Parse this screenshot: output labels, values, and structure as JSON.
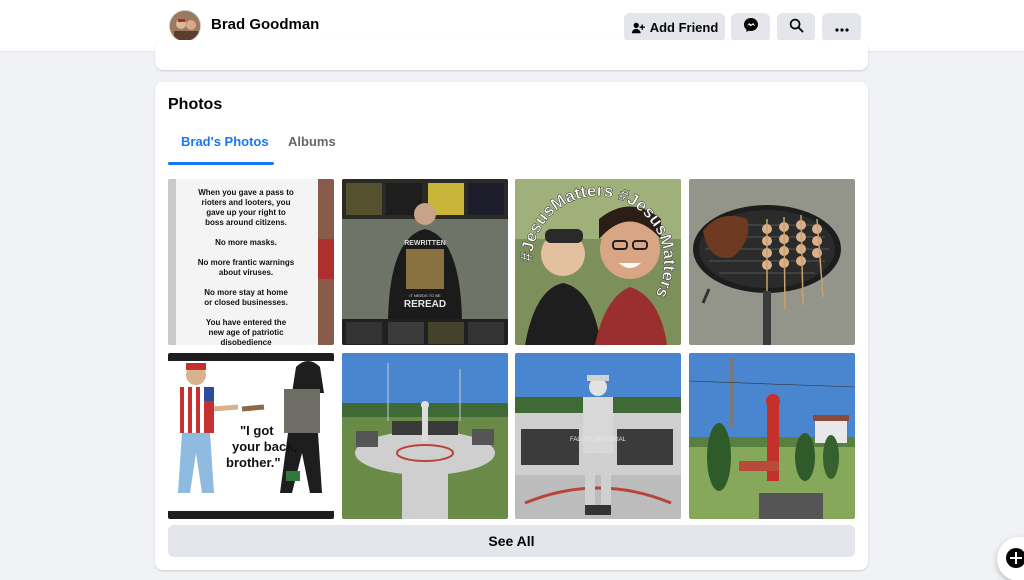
{
  "header": {
    "profile_name": "Brad Goodman",
    "add_friend_label": "Add Friend",
    "icons": [
      "add-friend-icon",
      "messenger-icon",
      "search-icon",
      "more-icon"
    ]
  },
  "photos": {
    "title": "Photos",
    "tabs": [
      {
        "label": "Brad's Photos",
        "active": true
      },
      {
        "label": "Albums",
        "active": false
      }
    ],
    "meme1_lines": [
      "When you gave a pass to",
      "rioters and looters, you",
      "gave up your right to",
      "boss around citizens.",
      "No more masks.",
      "No more frantic warnings",
      "about viruses.",
      "No more stay at home",
      "or closed businesses.",
      "You have entered the",
      "new age of patriotic",
      "disobedience"
    ],
    "shirt_text": [
      "REWRITTEN",
      "IT NEEDS TO BE",
      "REREAD"
    ],
    "jesus_text": "#JesusMatters #JesusMatters",
    "meme5_lines": [
      "\"I got",
      "your back,",
      "brother.\""
    ],
    "memorial_text": "FALLEN MEMORIAL",
    "see_all_label": "See All"
  },
  "colors": {
    "accent": "#1877f2",
    "button_bg": "#e4e6eb",
    "page_bg": "#f0f2f5"
  }
}
